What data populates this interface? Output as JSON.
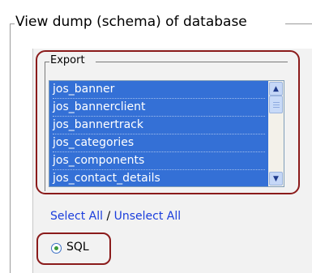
{
  "fieldset": {
    "legend": "View dump (schema) of database"
  },
  "export": {
    "legend": "Export",
    "tables": [
      "jos_banner",
      "jos_bannerclient",
      "jos_bannertrack",
      "jos_categories",
      "jos_components",
      "jos_contact_details"
    ]
  },
  "selection": {
    "select_all": "Select All",
    "separator": " / ",
    "unselect_all": "Unselect All"
  },
  "format": {
    "sql_label": "SQL",
    "sql_selected": true
  },
  "colors": {
    "selection_bg": "#3470d6",
    "highlight_border": "#8b1b1b",
    "link": "#1a3ddc"
  }
}
